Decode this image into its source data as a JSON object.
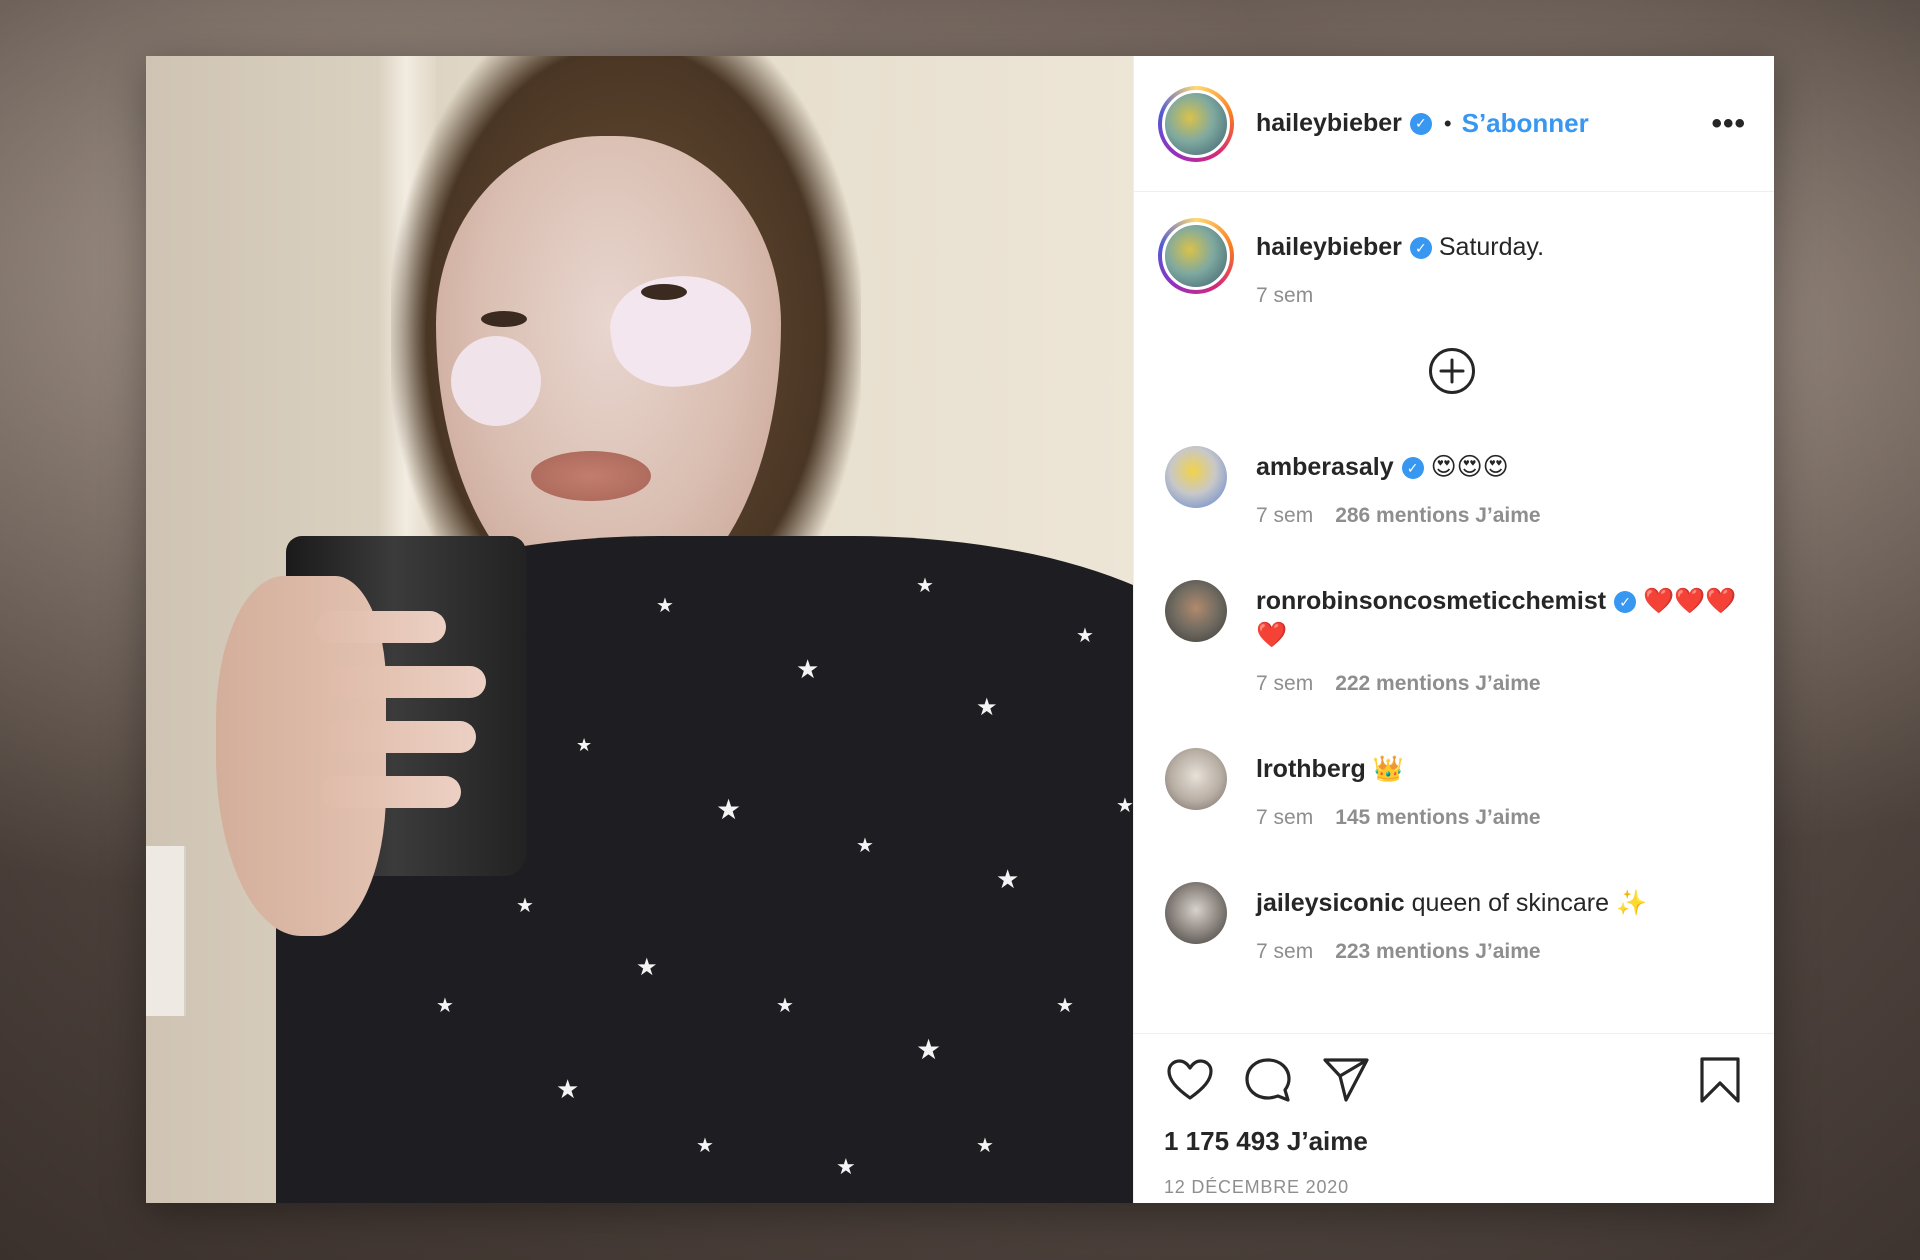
{
  "post": {
    "author": "haileybieber",
    "follow_label": "S’abonner",
    "more_label": "•••",
    "caption": {
      "username": "haileybieber",
      "text": "Saturday.",
      "age": "7 sem"
    },
    "load_more_label": "+",
    "comments": [
      {
        "username": "amberasaly",
        "verified": true,
        "text": "😍😍😍",
        "age": "7 sem",
        "likes": "286 mentions J’aime"
      },
      {
        "username": "ronrobinsoncosmeticchemist",
        "verified": true,
        "text": "❤️❤️❤️❤️",
        "age": "7 sem",
        "likes": "222 mentions J’aime"
      },
      {
        "username": "lrothberg",
        "verified": false,
        "text": "👑",
        "age": "7 sem",
        "likes": "145 mentions J’aime"
      },
      {
        "username": "jaileysiconic",
        "verified": false,
        "text": "queen of skincare ✨",
        "age": "7 sem",
        "likes": "223 mentions J’aime"
      }
    ],
    "like_count": "1 175 493 J’aime",
    "date": "12 DÉCEMBRE 2020"
  },
  "icons": {
    "verified": "verified-badge-icon",
    "like": "heart-icon",
    "comment": "comment-bubble-icon",
    "share": "paper-plane-icon",
    "save": "bookmark-icon",
    "more": "more-options-icon",
    "load_more": "plus-circle-icon"
  },
  "colors": {
    "link_blue": "#3897f0",
    "text": "#262626",
    "muted": "#8e8e8e"
  }
}
